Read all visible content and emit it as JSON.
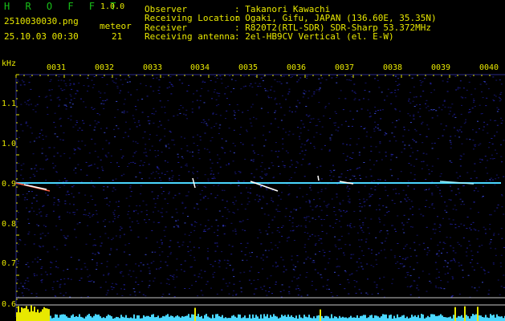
{
  "header": {
    "app_name": "H R O F F T",
    "version": "1.0.0",
    "file_name": "2510030030.png",
    "meteor_label": "meteor",
    "datetime": "25.10.03 00:30",
    "meteor_count": "21",
    "info": [
      {
        "label": "Observer",
        "value": ": Takanori Kawachi"
      },
      {
        "label": "Receiving Location",
        "value": ": Ogaki, Gifu, JAPAN (136.60E, 35.35N)"
      },
      {
        "label": "Receiver",
        "value": ": R820T2(RTL-SDR) SDR-Sharp 53.372MHz"
      },
      {
        "label": "Receiving antenna",
        "value": ": 2el-HB9CV Vertical (el. E-W)"
      }
    ]
  },
  "spectrogram": {
    "y_unit": "kHz",
    "y_ticks": [
      "1.1",
      "1.0",
      "0.9",
      "0.8",
      "0.7",
      "0.6"
    ],
    "x_ticks": [
      "0031",
      "0032",
      "0033",
      "0034",
      "0035",
      "0036",
      "0037",
      "0038",
      "0039",
      "0040"
    ],
    "carrier_khz": 0.9,
    "colors": {
      "label": "#e8e800",
      "carrier": "#4ad7ff",
      "noise": "#1a1a9a",
      "meteor": "#ffffff",
      "hit": "#ff6040"
    }
  }
}
